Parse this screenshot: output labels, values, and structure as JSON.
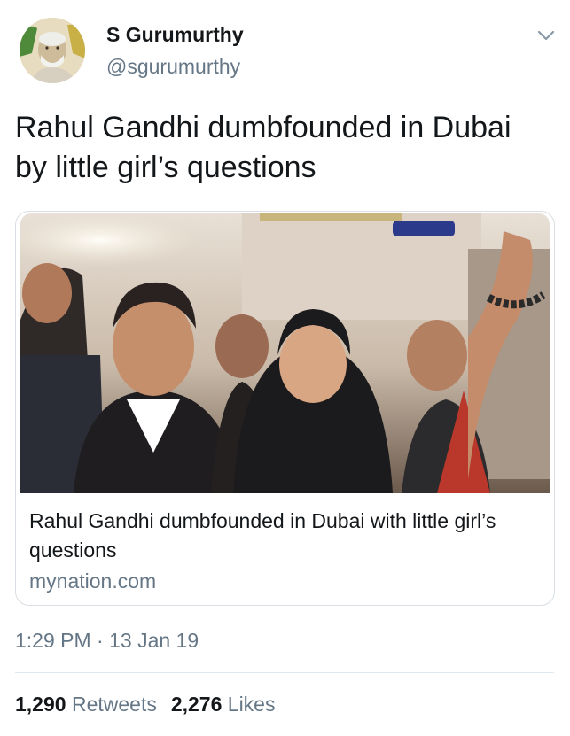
{
  "tweet": {
    "author_name": "S Gurumurthy",
    "author_handle": "@sgurumurthy",
    "text_line1": "Rahul Gandhi dumbfounded in Dubai",
    "text_line2": "by little girl’s questions",
    "card": {
      "title": "Rahul Gandhi dumbfounded in Dubai with little girl’s questions",
      "domain": "mynation.com"
    },
    "time": "1:29 PM",
    "separator": "·",
    "date": "13 Jan 19",
    "retweets_count": "1,290",
    "retweets_label": "Retweets",
    "likes_count": "2,276",
    "likes_label": "Likes"
  },
  "icons": {
    "menu": "chevron-down-icon",
    "avatar": "profile-avatar"
  },
  "colors": {
    "text_primary": "#14171a",
    "text_secondary": "#657786",
    "border": "#d8dee3"
  }
}
